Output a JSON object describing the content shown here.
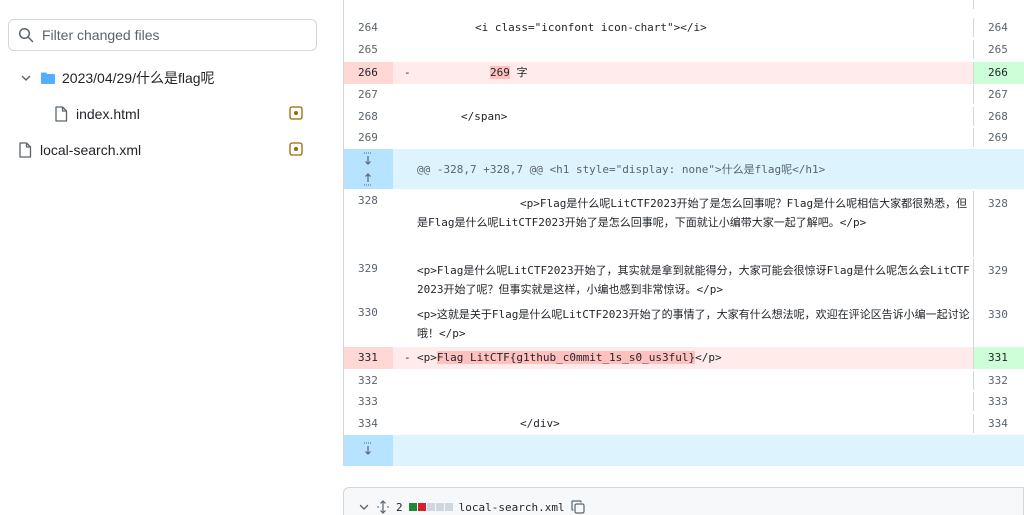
{
  "sidebar": {
    "filter_placeholder": "Filter changed files",
    "folder_name": "2023/04/29/什么是flag呢",
    "files": [
      {
        "name": "index.html",
        "status": "modified"
      },
      {
        "name": "local-search.xml",
        "status": "modified"
      }
    ]
  },
  "diff": {
    "lines": [
      {
        "type": "ctx",
        "left": "264",
        "right": "264",
        "code": "<i class=\"iconfont icon-chart\"></i>"
      },
      {
        "type": "ctx",
        "left": "265",
        "right": "265",
        "code": ""
      },
      {
        "type": "del",
        "left": "266",
        "right": "266",
        "marker": "-",
        "code_hl": "269",
        "code_rest": " 字"
      },
      {
        "type": "ctx",
        "left": "267",
        "right": "267",
        "code": ""
      },
      {
        "type": "ctx",
        "left": "268",
        "right": "268",
        "code": "</span>"
      },
      {
        "type": "ctx",
        "left": "269",
        "right": "269",
        "code": ""
      }
    ],
    "hunk_header": "@@ -328,7 +328,7 @@ <h1 style=\"display: none\">什么是flag呢</h1>",
    "lines2": [
      {
        "left": "328",
        "right": "328",
        "code": "<p>Flag是什么呢LitCTF2023开始了是怎么回事呢？Flag是什么呢相信大家都很熟悉，但是Flag是什么呢LitCTF2023开始了是怎么回事呢，下面就让小编带大家一起了解吧。</p>"
      },
      {
        "left": "329",
        "right": "329",
        "code": "<p>Flag是什么呢LitCTF2023开始了，其实就是拿到就能得分，大家可能会很惊讶Flag是什么呢怎么会LitCTF2023开始了呢？但事实就是这样，小编也感到非常惊讶。</p>"
      },
      {
        "left": "330",
        "right": "330",
        "code": "<p>这就是关于Flag是什么呢LitCTF2023开始了的事情了，大家有什么想法呢，欢迎在评论区告诉小编一起讨论哦！</p>"
      }
    ],
    "del2": {
      "left": "331",
      "right": "331",
      "marker": "-",
      "code_open": "<p>",
      "code_hl": "Flag LitCTF{g1thub_c0mmit_1s_s0_us3ful}",
      "code_close": "</p>"
    },
    "lines3": [
      {
        "left": "332",
        "right": "332",
        "code": ""
      },
      {
        "left": "333",
        "right": "333",
        "code": ""
      },
      {
        "left": "334",
        "right": "334",
        "code": "</div>"
      }
    ]
  },
  "next_file": {
    "changes": "2",
    "name": "local-search.xml"
  },
  "colors": {
    "deletion": "#ffebe9",
    "addition": "#e6ffec",
    "hunk": "#ddf4ff",
    "accent": "#54aeff",
    "modified": "#9a6700"
  }
}
